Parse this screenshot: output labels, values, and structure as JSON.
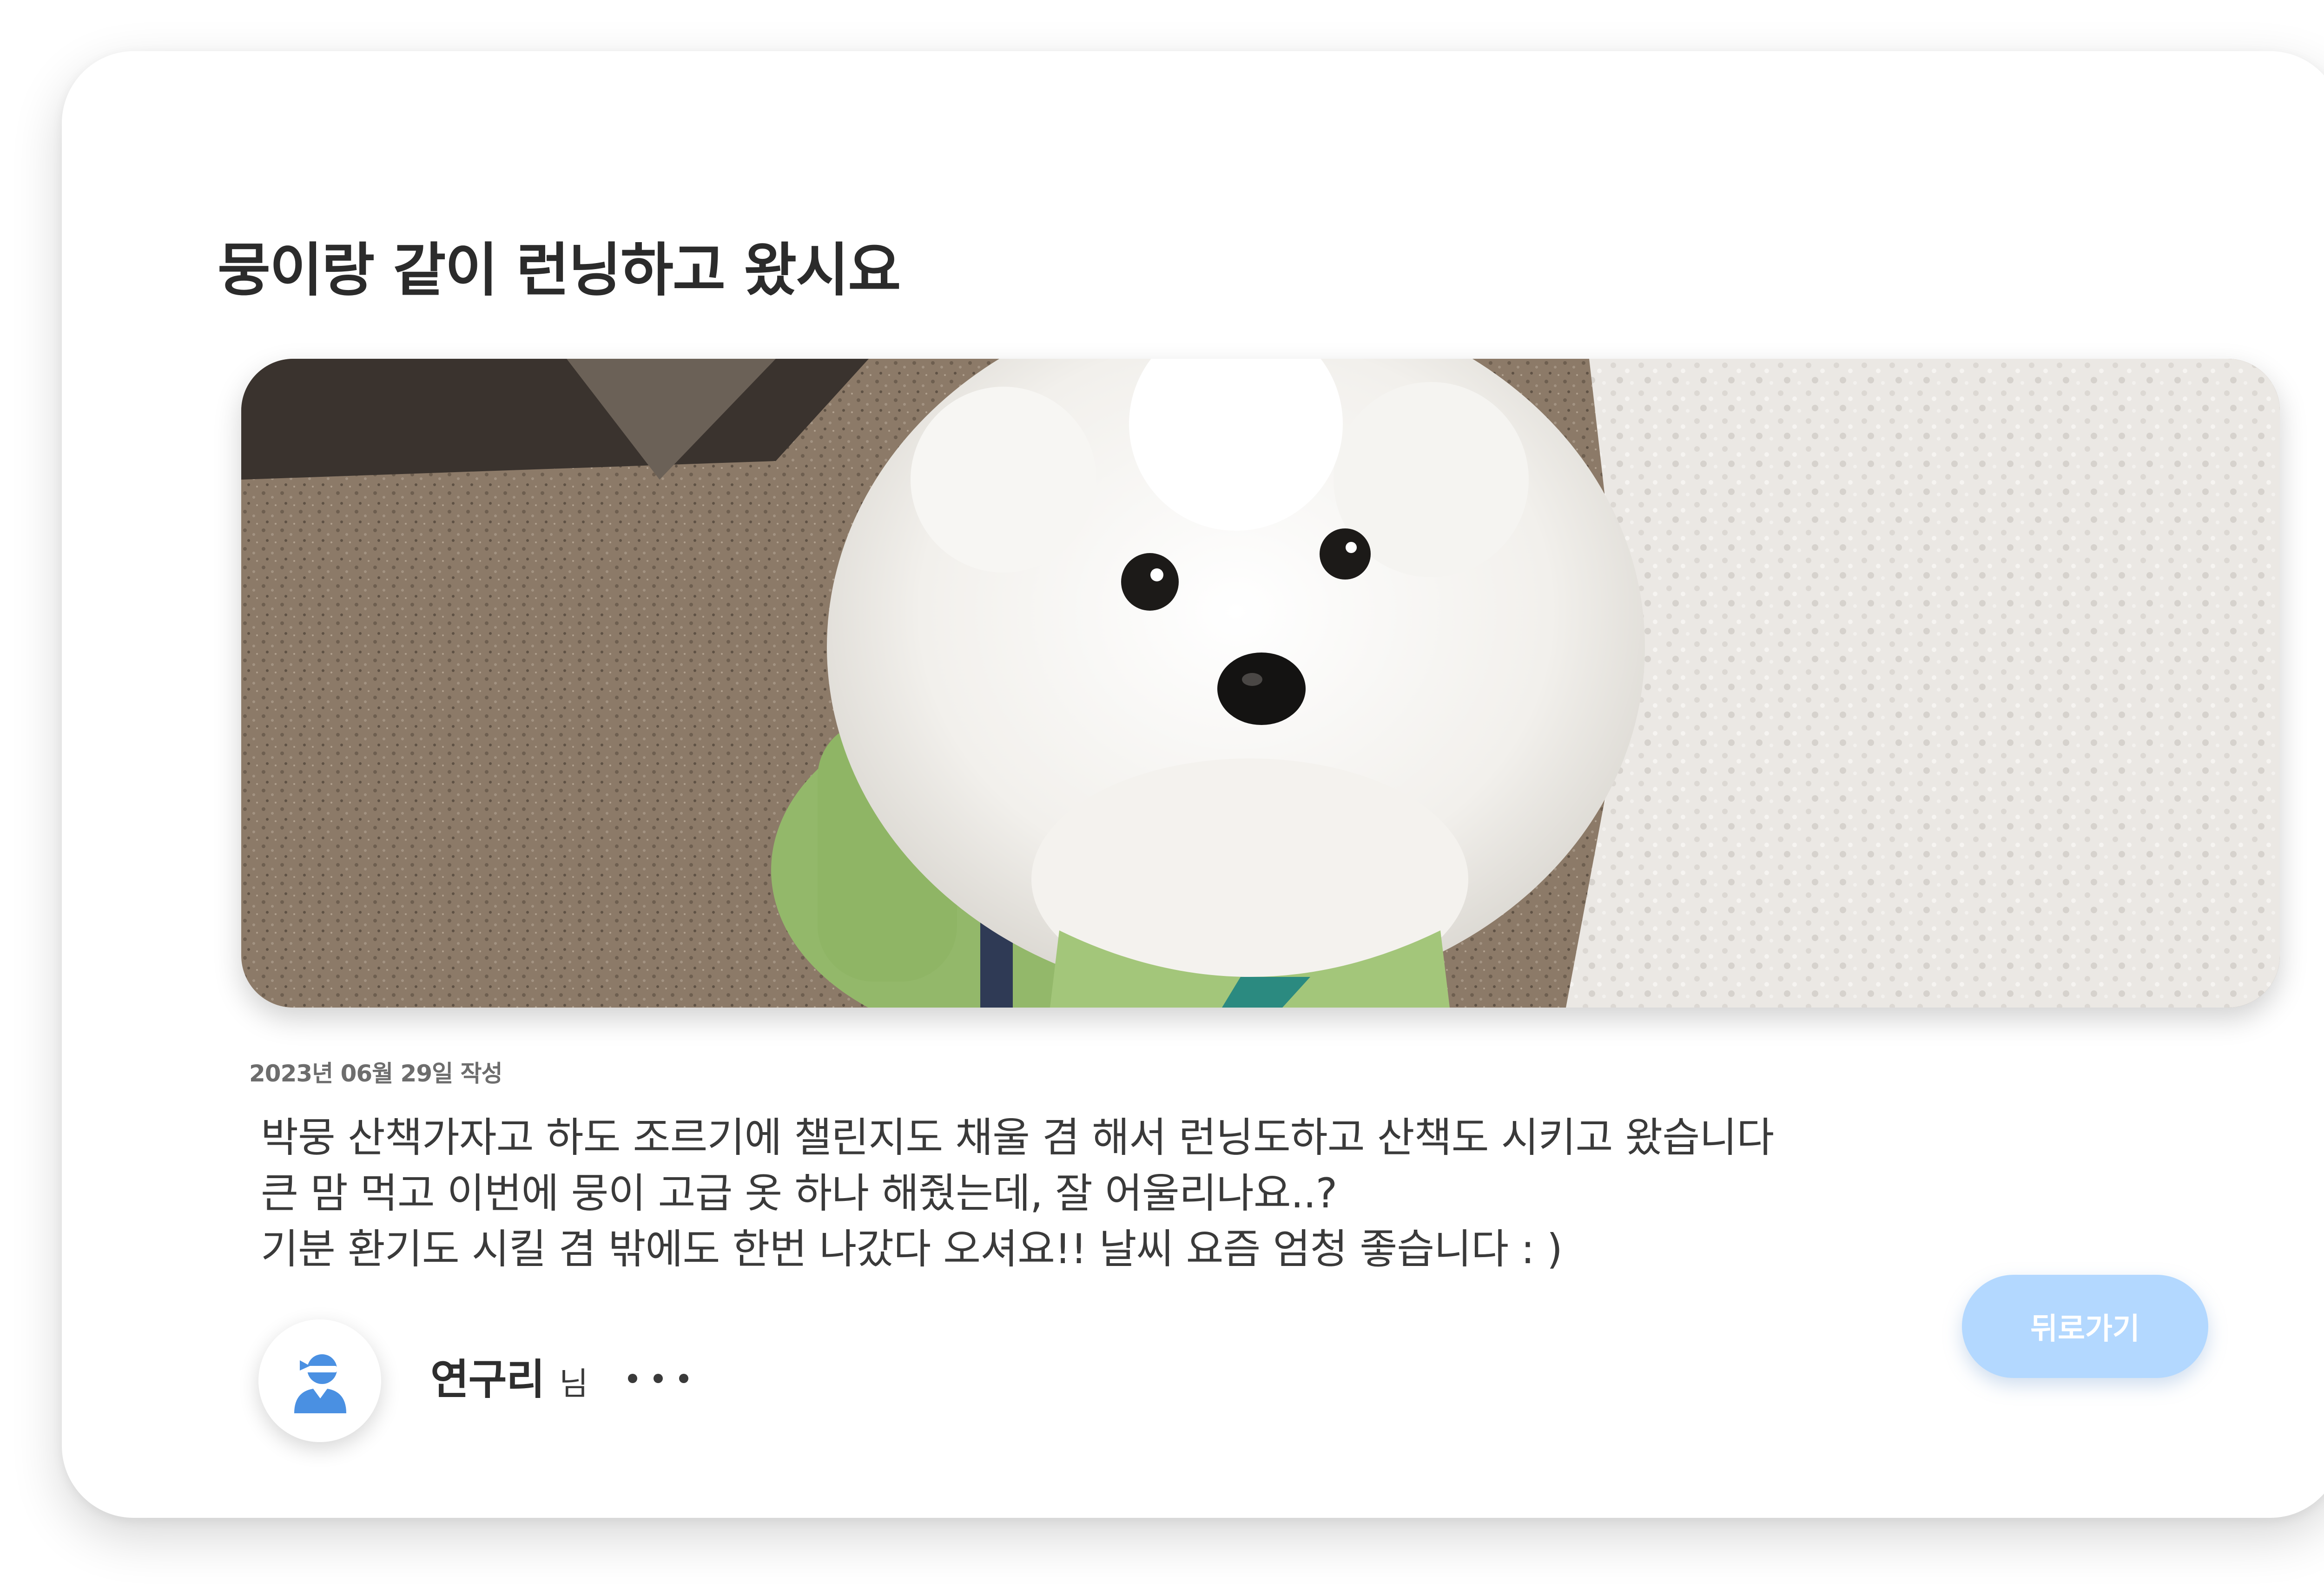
{
  "post": {
    "title": "뭉이랑 같이 런닝하고 왔시요",
    "date": "2023년 06월 29일 작성",
    "body_lines": [
      "박뭉 산책가자고 하도 조르기에 챌린지도 채울 겸 해서 런닝도하고 산책도 시키고 왔습니다",
      "큰 맘 먹고 이번에 뭉이 고급 옷 하나 해줬는데, 잘 어울리나요..?",
      "기분 환기도 시킬 겸 밖에도 한번 나갔다 오셔요!! 날씨 요즘 엄청 좋습니다 : )"
    ],
    "image_subject": "white poodle dog wearing green jacket"
  },
  "author": {
    "name": "연구리",
    "suffix": "님",
    "avatar_icon": "user-avatar-icon"
  },
  "actions": {
    "more_icon": "more-dots-icon",
    "back_label": "뒤로가기"
  },
  "colors": {
    "accent": "#b3d8ff",
    "avatar_blue": "#4a90e2",
    "title_text": "#2b2b2b",
    "muted_text": "#6d6d6d"
  }
}
